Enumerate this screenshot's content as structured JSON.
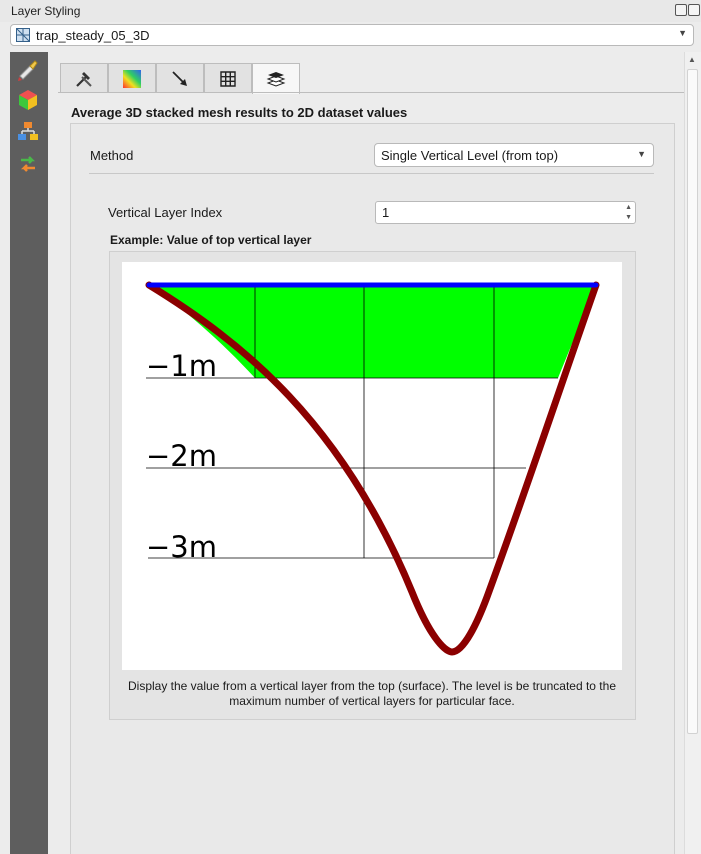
{
  "window": {
    "title": "Layer Styling"
  },
  "layer_selector": {
    "value": "trap_steady_05_3D"
  },
  "sidebar": {
    "items": [
      {
        "icon": "paintbrush-icon"
      },
      {
        "icon": "3d-cube-icon"
      },
      {
        "icon": "layer-tree-icon"
      },
      {
        "icon": "history-icon"
      }
    ]
  },
  "tabs": [
    {
      "icon": "hammer-wrench-icon"
    },
    {
      "icon": "color-ramp-icon"
    },
    {
      "icon": "vector-arrow-icon"
    },
    {
      "icon": "grid-icon"
    },
    {
      "icon": "stacked-layers-icon",
      "active": true
    }
  ],
  "section": {
    "heading": "Average 3D stacked mesh results to 2D dataset values"
  },
  "method": {
    "label": "Method",
    "value": "Single Vertical Level (from top)"
  },
  "vertical_layer_index": {
    "label": "Vertical Layer Index",
    "value": "1"
  },
  "example": {
    "title": "Example: Value of top vertical layer",
    "depth_labels": [
      "−1m",
      "−2m",
      "−3m"
    ],
    "description": "Display the value from a vertical layer from the top (surface). The level is be truncated to the maximum number of vertical layers for particular face.",
    "colors": {
      "fill": "#00ff00",
      "surface": "#0000ff",
      "bed": "#8b0000"
    }
  }
}
